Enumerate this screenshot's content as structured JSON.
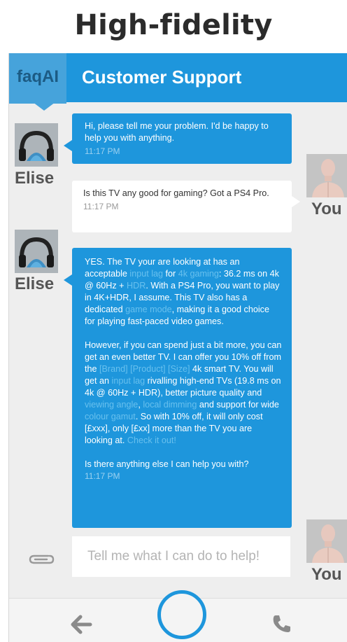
{
  "heading": "High-fidelity",
  "app_bar": {
    "logo": "faqAI",
    "title": "Customer Support",
    "color": "#1e96dc"
  },
  "agent": {
    "name": "Elise",
    "avatar_icon": "headphones-avatar-icon"
  },
  "user": {
    "name": "You",
    "avatar_icon": "mannequin-avatar-icon"
  },
  "messages": [
    {
      "from": "agent",
      "text": "Hi, please tell me your problem. I'd be happy to help you with anything.",
      "time": "11:17 PM"
    },
    {
      "from": "user",
      "text": "Is this TV any good for gaming? Got a PS4 Pro.",
      "time": "11:17 PM"
    },
    {
      "from": "agent",
      "time": "11:17 PM",
      "p1": {
        "t1": "YES. The TV your are looking at has an acceptable ",
        "l1": "input lag",
        "t2": " for ",
        "l2": "4k gaming",
        "t3": ": 36.2 ms on 4k @ 60Hz + ",
        "l3": "HDR",
        "t4": ". With a PS4 Pro, you want to play in 4K+HDR, I assume. This TV also has a dedicated ",
        "l4": "game mode",
        "t5": ", making it a good choice for playing fast-paced video games."
      },
      "p2": {
        "t1": "However, if you can spend just a bit more, you can get an even better TV. I can offer you 10% off from the ",
        "l1": "[Brand] [Product] [Size]",
        "t2": " 4k smart TV. You will get an ",
        "l2": "input lag",
        "t3": " rivalling high-end TVs (19.8 ms on 4k @ 60Hz + HDR), better picture quality and ",
        "l3": "viewing angle",
        "t4": ", ",
        "l4": "local dimming",
        "t5": " and support for wide ",
        "l5": "colour gamut",
        "t6": ". So with 10% off, it will only cost [£xxx], only [£xx] more than the TV you are looking at. ",
        "l6": "Check it out!"
      },
      "p3": "Is there anything else I can help you with?"
    }
  ],
  "composer": {
    "placeholder": "Tell me what I can do to help!",
    "attach_icon": "paperclip-icon"
  },
  "nav": {
    "back_icon": "arrow-left-icon",
    "home_icon": "home-circle-icon",
    "call_icon": "phone-icon"
  }
}
